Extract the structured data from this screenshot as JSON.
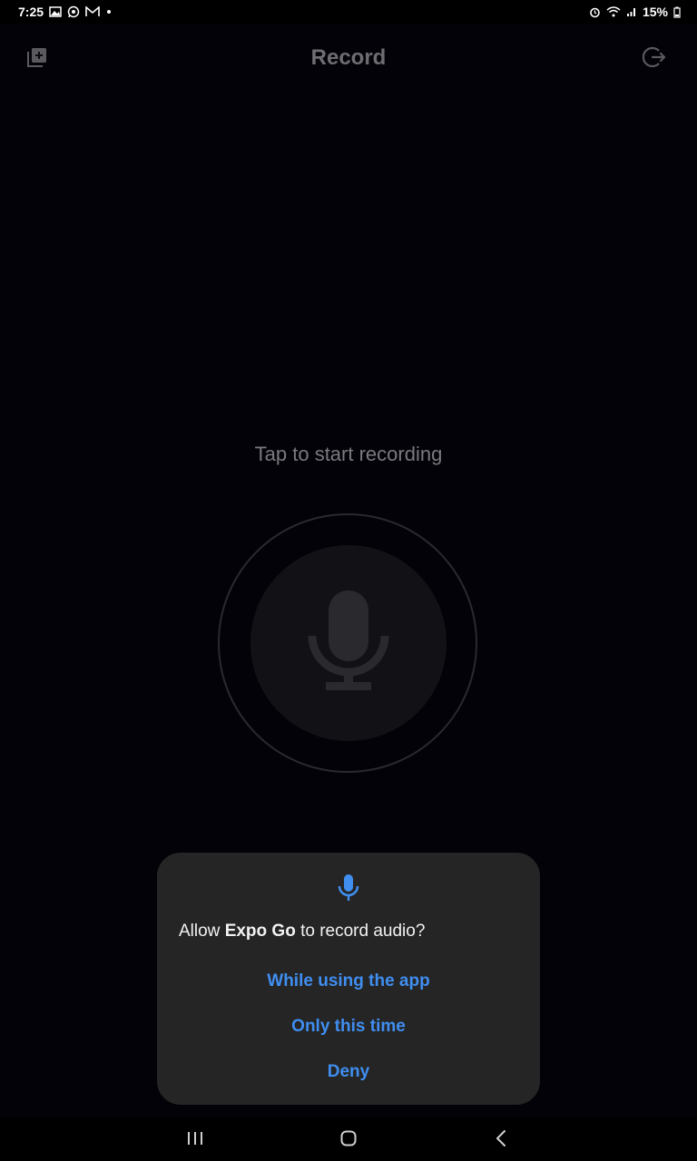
{
  "status_bar": {
    "time": "7:25",
    "battery": "15%",
    "icons": [
      "gallery-icon",
      "whatsapp-icon",
      "gmail-icon",
      "alarm-icon",
      "wifi-icon",
      "signal-icon",
      "battery-icon"
    ]
  },
  "header": {
    "title": "Record",
    "left_icon": "add-library-icon",
    "right_icon": "logout-icon"
  },
  "main": {
    "hint": "Tap to start recording",
    "record_icon": "microphone-icon"
  },
  "dialog": {
    "icon": "microphone-icon",
    "prefix": "Allow ",
    "app_name": "Expo Go",
    "suffix": " to record audio?",
    "options": [
      {
        "label": "While using the app"
      },
      {
        "label": "Only this time"
      },
      {
        "label": "Deny"
      }
    ],
    "accent_color": "#3f8ef0"
  },
  "nav": {
    "recent": "recent-apps-icon",
    "home": "home-icon",
    "back": "back-icon"
  }
}
